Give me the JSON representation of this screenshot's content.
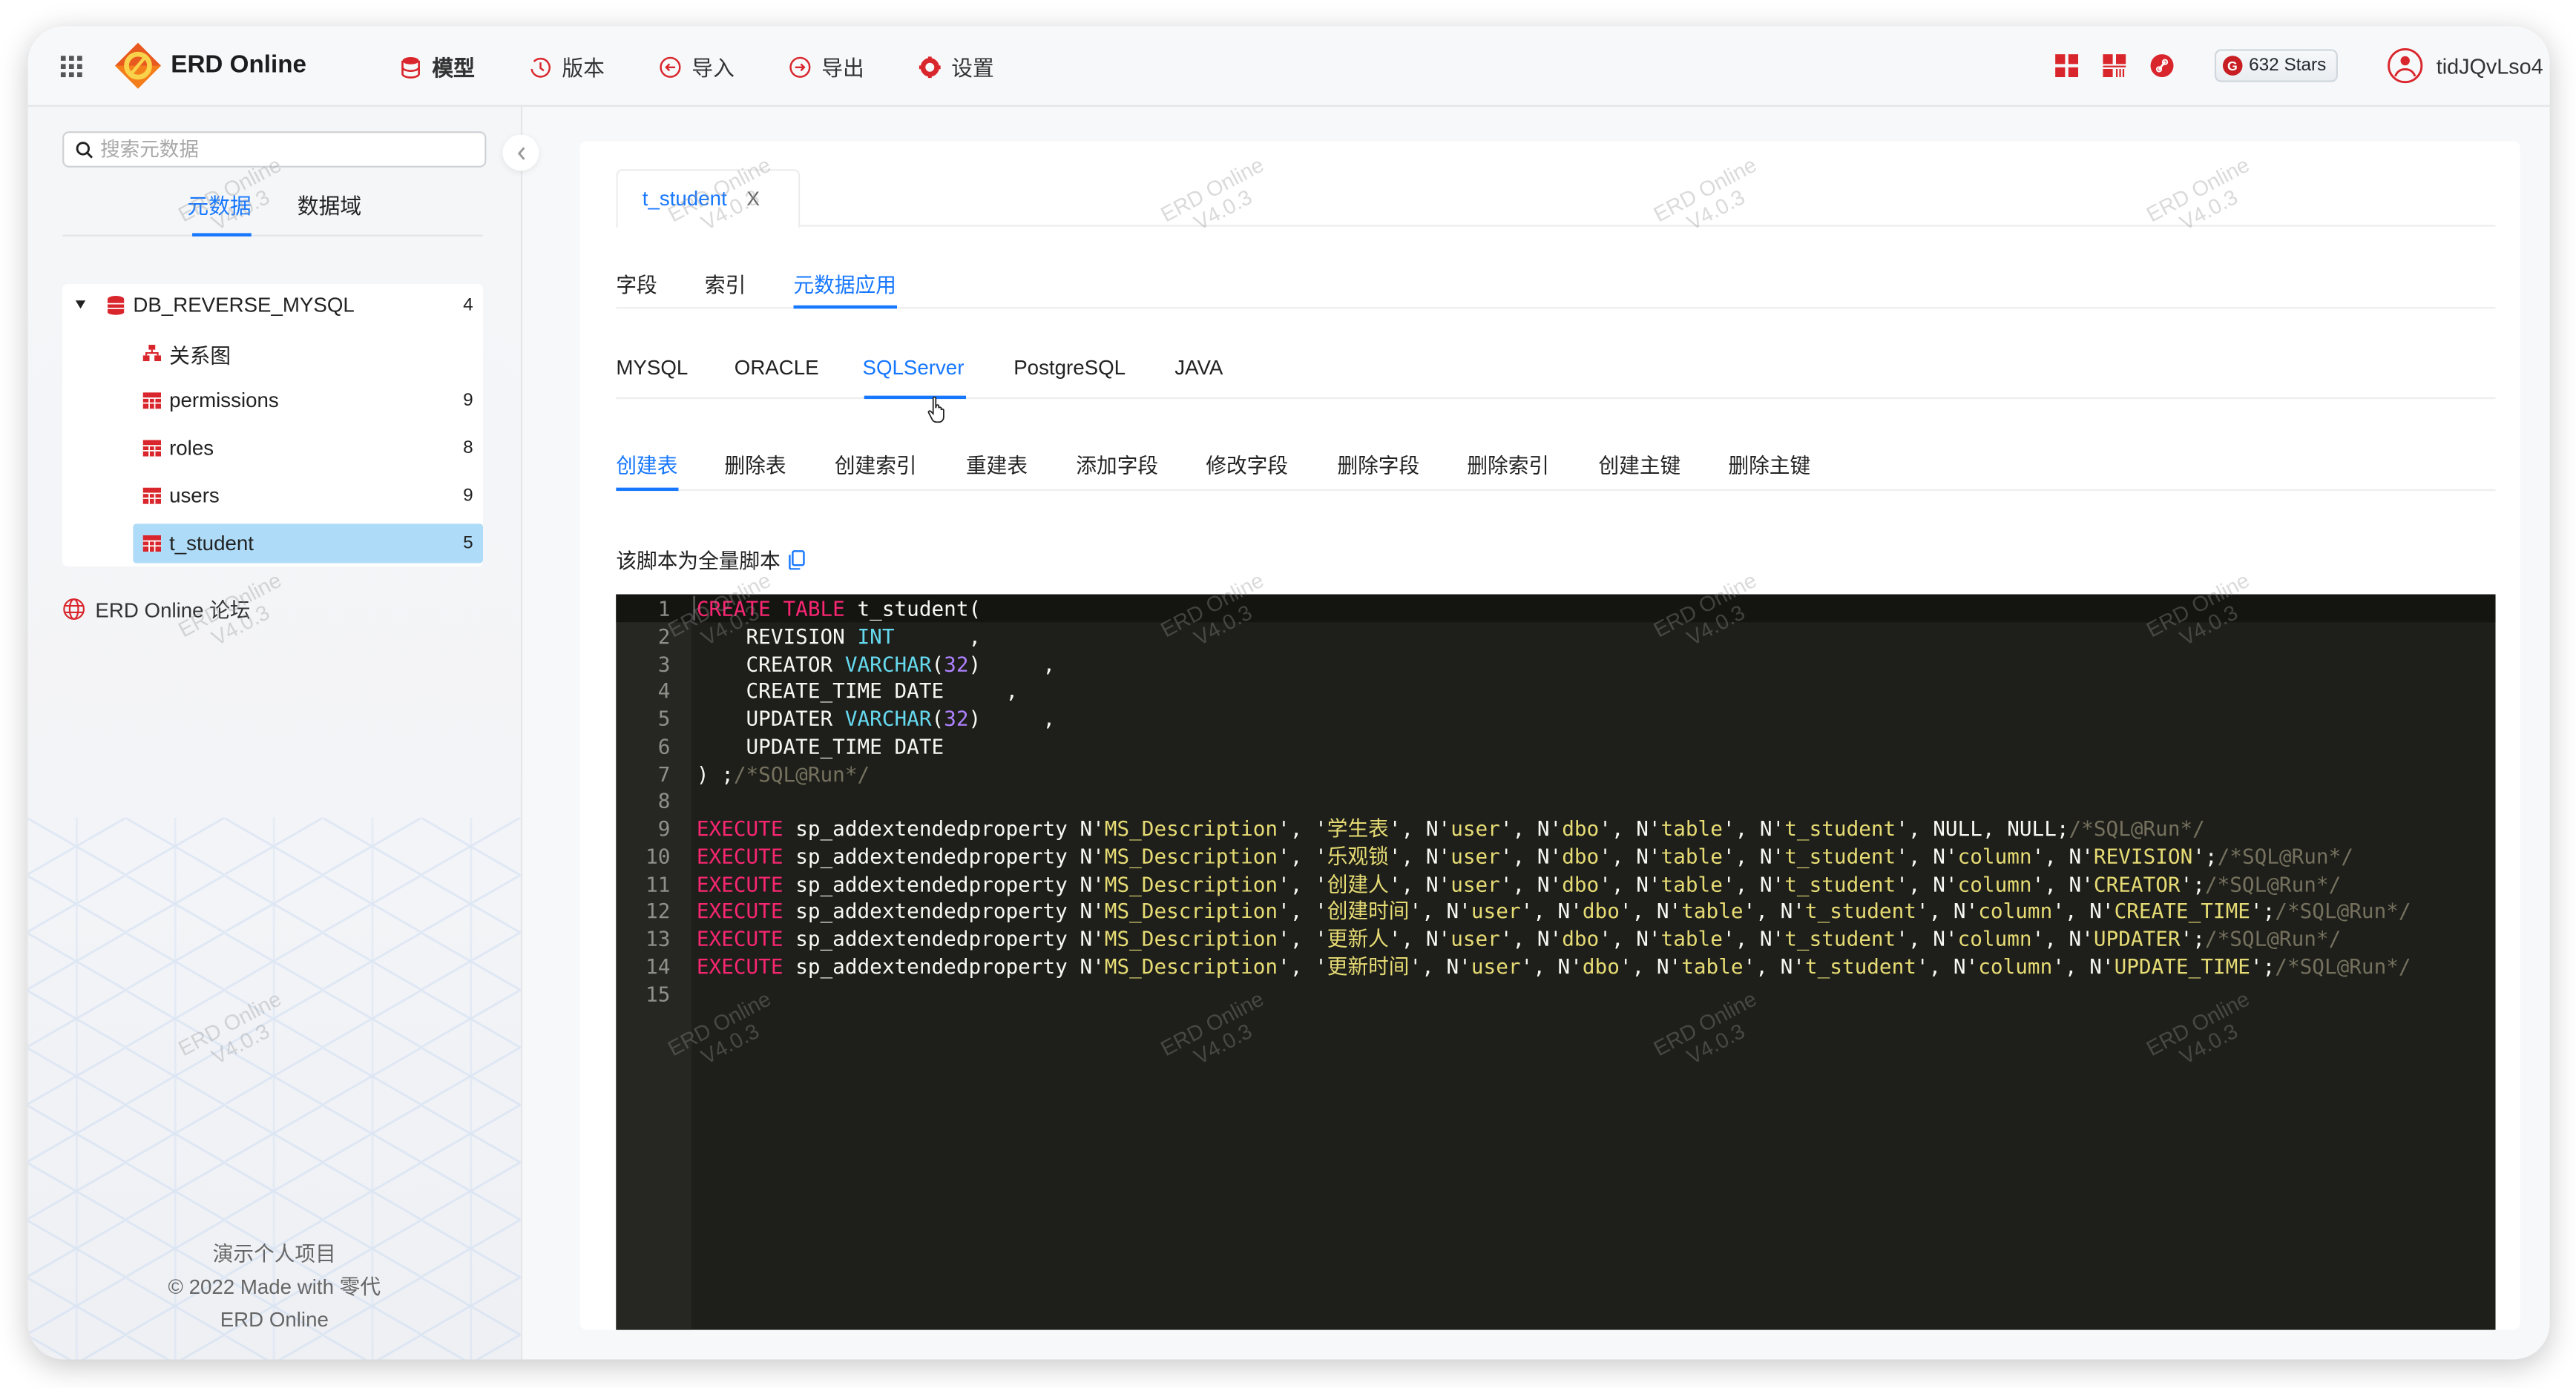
{
  "header": {
    "brand": "ERD Online",
    "nav": [
      {
        "label": "模型",
        "icon": "model-db-icon"
      },
      {
        "label": "版本",
        "icon": "history-icon"
      },
      {
        "label": "导入",
        "icon": "import-icon"
      },
      {
        "label": "导出",
        "icon": "export-icon"
      },
      {
        "label": "设置",
        "icon": "gear-icon"
      }
    ],
    "stars_label": "632 Stars",
    "stars_logo": "G",
    "username": "tidJQvLso4"
  },
  "sidebar": {
    "search_placeholder": "搜索元数据",
    "tabs": [
      {
        "label": "元数据",
        "active": true
      },
      {
        "label": "数据域",
        "active": false
      }
    ],
    "tree": {
      "root": {
        "label": "DB_REVERSE_MYSQL",
        "count": "4",
        "expanded": true
      },
      "children": [
        {
          "label": "关系图",
          "count": "",
          "icon": "diagram-icon"
        },
        {
          "label": "permissions",
          "count": "9",
          "icon": "table-icon"
        },
        {
          "label": "roles",
          "count": "8",
          "icon": "table-icon"
        },
        {
          "label": "users",
          "count": "9",
          "icon": "table-icon"
        },
        {
          "label": "t_student",
          "count": "5",
          "icon": "table-icon",
          "selected": true
        }
      ]
    },
    "forum_link": "ERD Online 论坛",
    "footer": [
      "演示个人项目",
      "© 2022 Made with 零代",
      "ERD Online"
    ]
  },
  "main": {
    "open_tab": {
      "label": "t_student",
      "close": "X"
    },
    "section_tabs": [
      {
        "label": "字段",
        "active": false
      },
      {
        "label": "索引",
        "active": false
      },
      {
        "label": "元数据应用",
        "active": true
      }
    ],
    "db_tabs": [
      {
        "label": "MYSQL",
        "active": false
      },
      {
        "label": "ORACLE",
        "active": false
      },
      {
        "label": "SQLServer",
        "active": true
      },
      {
        "label": "PostgreSQL",
        "active": false
      },
      {
        "label": "JAVA",
        "active": false
      }
    ],
    "script_tabs": [
      {
        "label": "创建表",
        "active": true
      },
      {
        "label": "删除表",
        "active": false
      },
      {
        "label": "创建索引",
        "active": false
      },
      {
        "label": "重建表",
        "active": false
      },
      {
        "label": "添加字段",
        "active": false
      },
      {
        "label": "修改字段",
        "active": false
      },
      {
        "label": "删除字段",
        "active": false
      },
      {
        "label": "删除索引",
        "active": false
      },
      {
        "label": "创建主键",
        "active": false
      },
      {
        "label": "删除主键",
        "active": false
      }
    ],
    "script_note": "该脚本为全量脚本",
    "code_lines": [
      [
        [
          "kw",
          "CREATE TABLE"
        ],
        [
          "p",
          " t_student("
        ]
      ],
      [
        [
          "p",
          "    REVISION "
        ],
        [
          "ty",
          "INT"
        ],
        [
          "p",
          "      ,"
        ]
      ],
      [
        [
          "p",
          "    CREATOR "
        ],
        [
          "ty",
          "VARCHAR"
        ],
        [
          "p",
          "("
        ],
        [
          "nm",
          "32"
        ],
        [
          "p",
          ")     ,"
        ]
      ],
      [
        [
          "p",
          "    CREATE_TIME DATE     ,"
        ]
      ],
      [
        [
          "p",
          "    UPDATER "
        ],
        [
          "ty",
          "VARCHAR"
        ],
        [
          "p",
          "("
        ],
        [
          "nm",
          "32"
        ],
        [
          "p",
          ")     ,"
        ]
      ],
      [
        [
          "p",
          "    UPDATE_TIME DATE"
        ]
      ],
      [
        [
          "p",
          ") ;"
        ],
        [
          "cm",
          "/*SQL@Run*/"
        ]
      ],
      [
        [
          "p",
          ""
        ]
      ],
      [
        [
          "kw",
          "EXECUTE"
        ],
        [
          "p",
          " sp_addextendedproperty N'"
        ],
        [
          "st",
          "MS_Description"
        ],
        [
          "p",
          "', '"
        ],
        [
          "st",
          "学生表"
        ],
        [
          "p",
          "', N'"
        ],
        [
          "st",
          "user"
        ],
        [
          "p",
          "', N'"
        ],
        [
          "st",
          "dbo"
        ],
        [
          "p",
          "', N'"
        ],
        [
          "st",
          "table"
        ],
        [
          "p",
          "', N'"
        ],
        [
          "st",
          "t_student"
        ],
        [
          "p",
          "', NULL, NULL;"
        ],
        [
          "cm",
          "/*SQL@Run*/"
        ]
      ],
      [
        [
          "kw",
          "EXECUTE"
        ],
        [
          "p",
          " sp_addextendedproperty N'"
        ],
        [
          "st",
          "MS_Description"
        ],
        [
          "p",
          "', '"
        ],
        [
          "st",
          "乐观锁"
        ],
        [
          "p",
          "', N'"
        ],
        [
          "st",
          "user"
        ],
        [
          "p",
          "', N'"
        ],
        [
          "st",
          "dbo"
        ],
        [
          "p",
          "', N'"
        ],
        [
          "st",
          "table"
        ],
        [
          "p",
          "', N'"
        ],
        [
          "st",
          "t_student"
        ],
        [
          "p",
          "', N'"
        ],
        [
          "st",
          "column"
        ],
        [
          "p",
          "', N'"
        ],
        [
          "st",
          "REVISION"
        ],
        [
          "p",
          "';"
        ],
        [
          "cm",
          "/*SQL@Run*/"
        ]
      ],
      [
        [
          "kw",
          "EXECUTE"
        ],
        [
          "p",
          " sp_addextendedproperty N'"
        ],
        [
          "st",
          "MS_Description"
        ],
        [
          "p",
          "', '"
        ],
        [
          "st",
          "创建人"
        ],
        [
          "p",
          "', N'"
        ],
        [
          "st",
          "user"
        ],
        [
          "p",
          "', N'"
        ],
        [
          "st",
          "dbo"
        ],
        [
          "p",
          "', N'"
        ],
        [
          "st",
          "table"
        ],
        [
          "p",
          "', N'"
        ],
        [
          "st",
          "t_student"
        ],
        [
          "p",
          "', N'"
        ],
        [
          "st",
          "column"
        ],
        [
          "p",
          "', N'"
        ],
        [
          "st",
          "CREATOR"
        ],
        [
          "p",
          "';"
        ],
        [
          "cm",
          "/*SQL@Run*/"
        ]
      ],
      [
        [
          "kw",
          "EXECUTE"
        ],
        [
          "p",
          " sp_addextendedproperty N'"
        ],
        [
          "st",
          "MS_Description"
        ],
        [
          "p",
          "', '"
        ],
        [
          "st",
          "创建时间"
        ],
        [
          "p",
          "', N'"
        ],
        [
          "st",
          "user"
        ],
        [
          "p",
          "', N'"
        ],
        [
          "st",
          "dbo"
        ],
        [
          "p",
          "', N'"
        ],
        [
          "st",
          "table"
        ],
        [
          "p",
          "', N'"
        ],
        [
          "st",
          "t_student"
        ],
        [
          "p",
          "', N'"
        ],
        [
          "st",
          "column"
        ],
        [
          "p",
          "', N'"
        ],
        [
          "st",
          "CREATE_TIME"
        ],
        [
          "p",
          "';"
        ],
        [
          "cm",
          "/*SQL@Run*/"
        ]
      ],
      [
        [
          "kw",
          "EXECUTE"
        ],
        [
          "p",
          " sp_addextendedproperty N'"
        ],
        [
          "st",
          "MS_Description"
        ],
        [
          "p",
          "', '"
        ],
        [
          "st",
          "更新人"
        ],
        [
          "p",
          "', N'"
        ],
        [
          "st",
          "user"
        ],
        [
          "p",
          "', N'"
        ],
        [
          "st",
          "dbo"
        ],
        [
          "p",
          "', N'"
        ],
        [
          "st",
          "table"
        ],
        [
          "p",
          "', N'"
        ],
        [
          "st",
          "t_student"
        ],
        [
          "p",
          "', N'"
        ],
        [
          "st",
          "column"
        ],
        [
          "p",
          "', N'"
        ],
        [
          "st",
          "UPDATER"
        ],
        [
          "p",
          "';"
        ],
        [
          "cm",
          "/*SQL@Run*/"
        ]
      ],
      [
        [
          "kw",
          "EXECUTE"
        ],
        [
          "p",
          " sp_addextendedproperty N'"
        ],
        [
          "st",
          "MS_Description"
        ],
        [
          "p",
          "', '"
        ],
        [
          "st",
          "更新时间"
        ],
        [
          "p",
          "', N'"
        ],
        [
          "st",
          "user"
        ],
        [
          "p",
          "', N'"
        ],
        [
          "st",
          "dbo"
        ],
        [
          "p",
          "', N'"
        ],
        [
          "st",
          "table"
        ],
        [
          "p",
          "', N'"
        ],
        [
          "st",
          "t_student"
        ],
        [
          "p",
          "', N'"
        ],
        [
          "st",
          "column"
        ],
        [
          "p",
          "', N'"
        ],
        [
          "st",
          "UPDATE_TIME"
        ],
        [
          "p",
          "';"
        ],
        [
          "cm",
          "/*SQL@Run*/"
        ]
      ],
      [
        [
          "p",
          ""
        ]
      ]
    ]
  },
  "watermark": {
    "line1": "ERD Online",
    "line2": "V4.0.3"
  },
  "colors": {
    "accent": "#1677ff",
    "brand_red": "#d9262c",
    "selected_bg": "#aedcf8",
    "editor_bg": "#1e1f1a"
  }
}
